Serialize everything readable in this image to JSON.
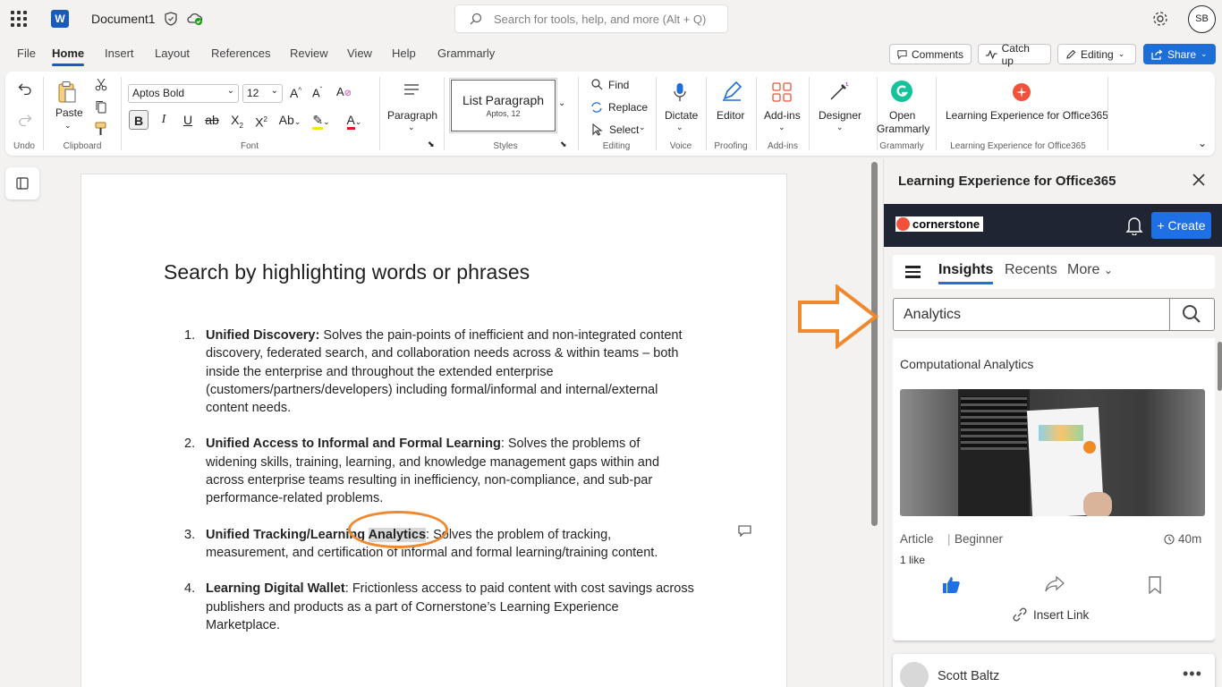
{
  "titlebar": {
    "doc_name": "Document1",
    "search_placeholder": "Search for tools, help, and more (Alt + Q)",
    "avatar_initials": "SB"
  },
  "tabs": [
    "File",
    "Home",
    "Insert",
    "Layout",
    "References",
    "Review",
    "View",
    "Help",
    "Grammarly"
  ],
  "active_tab": "Home",
  "top_buttons": {
    "comments": "Comments",
    "catch_up": "Catch up",
    "editing": "Editing",
    "share": "Share"
  },
  "ribbon": {
    "undo_group": "Undo",
    "paste": "Paste",
    "clipboard_group": "Clipboard",
    "font_name": "Aptos Bold",
    "font_size": "12",
    "font_group": "Font",
    "paragraph": "Paragraph",
    "style_name": "List Paragraph",
    "style_sub": "Aptos, 12",
    "styles_group": "Styles",
    "find": "Find",
    "replace": "Replace",
    "select": "Select",
    "editing_group": "Editing",
    "dictate": "Dictate",
    "voice_group": "Voice",
    "editor": "Editor",
    "proofing_group": "Proofing",
    "addins": "Add-ins",
    "addins_group": "Add-ins",
    "designer": "Designer",
    "open_grammarly_1": "Open",
    "open_grammarly_2": "Grammarly",
    "grammarly_group": "Grammarly",
    "lxo": "Learning Experience for Office365",
    "lxo_group": "Learning Experience for Office365"
  },
  "document": {
    "heading": "Search by highlighting words or phrases",
    "items": [
      {
        "num": "1.",
        "bold": "Unified Discovery:",
        "text": "  Solves the pain-points of inefficient and non-integrated content discovery, federated search, and collaboration needs across & within teams – both inside the enterprise and throughout the extended enterprise (customers/partners/developers) including formal/informal and internal/external content needs."
      },
      {
        "num": "2.",
        "bold": "Unified Access to Informal and Formal Learning",
        "text": ":  Solves the problems of widening skills, training, learning, and knowledge management gaps within and across enterprise teams resulting in inefficiency, non-compliance, and sub-par performance-related problems."
      },
      {
        "num": "3.",
        "bold": "Unified Tracking/Learning ",
        "highlight": "Analytics",
        "text": ": Solves the problem of tracking, measurement, and certification of informal and formal learning/training content."
      },
      {
        "num": "4.",
        "bold": "Learning Digital Wallet",
        "text": ": Frictionless access to paid content with cost savings across publishers and products as a part of Cornerstone’s Learning Experience Marketplace."
      }
    ]
  },
  "pane": {
    "title": "Learning Experience for Office365",
    "brand": "cornerstone",
    "create": "+ Create",
    "nav": [
      "Insights",
      "Recents",
      "More"
    ],
    "search_value": "Analytics",
    "card": {
      "title": "Computational Analytics",
      "type": "Article",
      "level": "Beginner",
      "duration": "40m",
      "likes": "1 like",
      "insert_link": "Insert Link"
    },
    "next_author": "Scott Baltz"
  },
  "colors": {
    "accent": "#185abd",
    "share": "#1e6ed8",
    "annotation": "#f0882e",
    "cs_bar": "#1f2532"
  }
}
